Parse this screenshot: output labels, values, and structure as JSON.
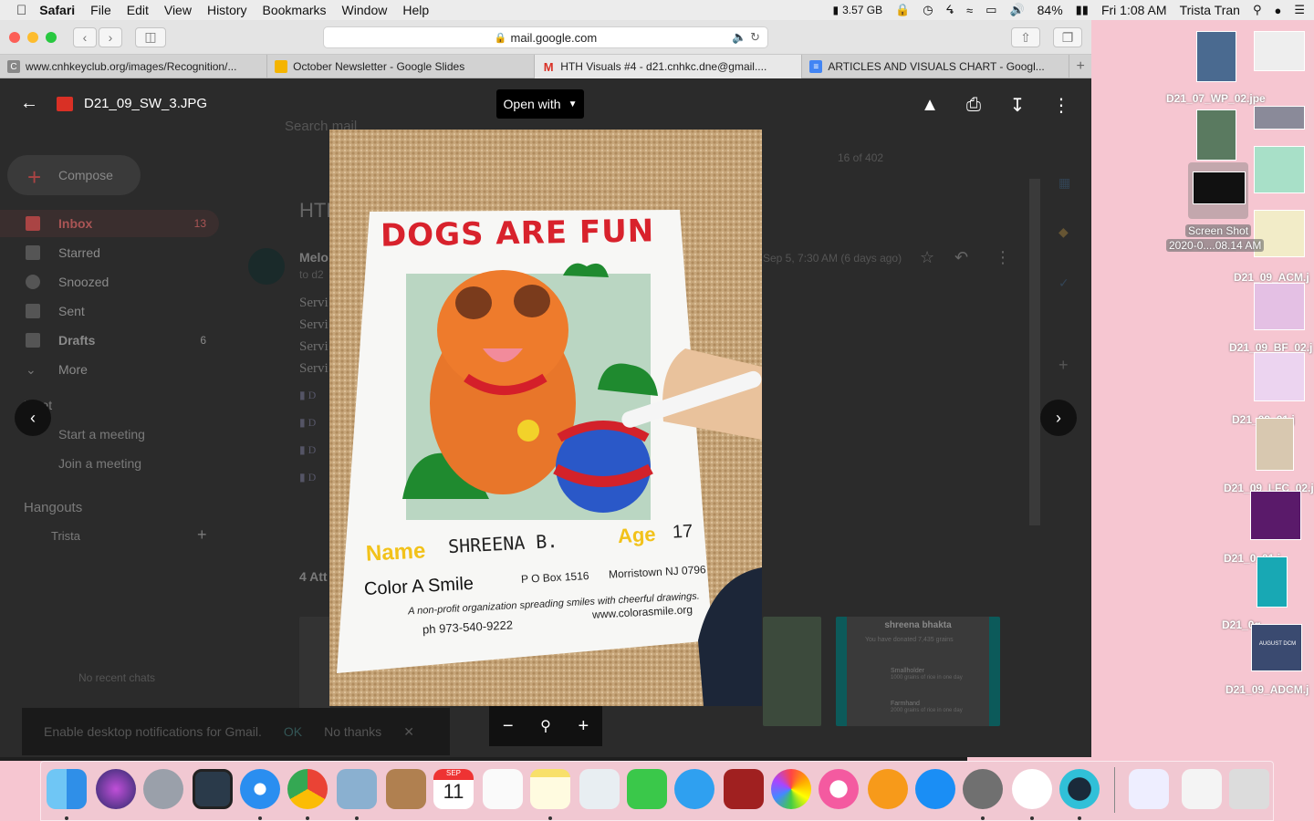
{
  "menubar": {
    "app": "Safari",
    "menus": [
      "File",
      "Edit",
      "View",
      "History",
      "Bookmarks",
      "Window",
      "Help"
    ],
    "memory": "3.57 GB",
    "battery": "84%",
    "datetime": "Fri 1:08 AM",
    "user": "Trista Tran"
  },
  "browser": {
    "url": "mail.google.com",
    "tabs": [
      {
        "label": "www.cnhkeyclub.org/images/Recognition/...",
        "fav": "C",
        "color": "#888888"
      },
      {
        "label": "October Newsletter - Google Slides",
        "fav": "",
        "color": "#f4b400"
      },
      {
        "label": "HTH Visuals #4 - d21.cnhkc.dne@gmail....",
        "fav": "M",
        "color": "#d93025"
      },
      {
        "label": "ARTICLES AND VISUALS CHART - Googl...",
        "fav": "≡",
        "color": "#4285f4"
      }
    ]
  },
  "gmail": {
    "search_placeholder": "Search mail",
    "compose": "Compose",
    "nav": [
      {
        "label": "Inbox",
        "count": "13"
      },
      {
        "label": "Starred",
        "count": ""
      },
      {
        "label": "Snoozed",
        "count": ""
      },
      {
        "label": "Sent",
        "count": ""
      },
      {
        "label": "Drafts",
        "count": "6"
      },
      {
        "label": "More",
        "count": ""
      }
    ],
    "meet_header": "Meet",
    "meet_items": [
      "Start a meeting",
      "Join a meeting"
    ],
    "hangouts_header": "Hangouts",
    "hangouts_user": "Trista",
    "no_chats": "No recent chats",
    "pagination": "16 of 402",
    "subject_prefix": "HTH",
    "sender_prefix": "Melo",
    "to_prefix": "to d2",
    "date": "Sep 5, 7:30 AM (6 days ago)",
    "body_lines": [
      "Servi",
      "Servi",
      "Servi",
      "Servi"
    ],
    "attach_items": [
      "D",
      "D",
      "D",
      "D"
    ],
    "attachments_label": "4 Att",
    "notification": "Enable desktop notifications for Gmail.",
    "notif_ok": "OK",
    "notif_no": "No thanks",
    "card_name": "shreena bhakta",
    "card_donated": "You have donated 7,435 grains",
    "card_ach1": "Smallholder",
    "card_ach1_sub": "1000 grains of rice in one day",
    "card_ach2": "Farmhand",
    "card_ach2_sub": "2000 grains of rice in one day"
  },
  "viewer": {
    "filename": "D21_09_SW_3.JPG",
    "open_with": "Open with",
    "photo": {
      "title": "DOGS ARE FUN",
      "name_label": "Name",
      "name_value": "SHREENA B.",
      "age_label": "Age",
      "age_value": "17",
      "org": "Color A Smile",
      "po": "P O Box 1516",
      "city": "Morristown NJ 0796",
      "tagline": "A non-profit organization spreading smiles with cheerful drawings.",
      "phone": "ph 973-540-9222",
      "web": "www.colorasmile.org"
    }
  },
  "desktop": {
    "labels": [
      "D21_07_WP_02.jpe",
      "Screen Shot",
      "2020-0....08.14 AM",
      "D21_09_ACM.j",
      "D21_09_BF_02.j",
      "D21_09_01.j",
      "D21_09_LFC_02.j",
      "D21_0_01.j",
      "D21_0g.",
      "D21_09_ADCM.j"
    ],
    "aug_text": "AUGUST DCM"
  },
  "calendar": {
    "month": "SEP",
    "day": "11"
  }
}
